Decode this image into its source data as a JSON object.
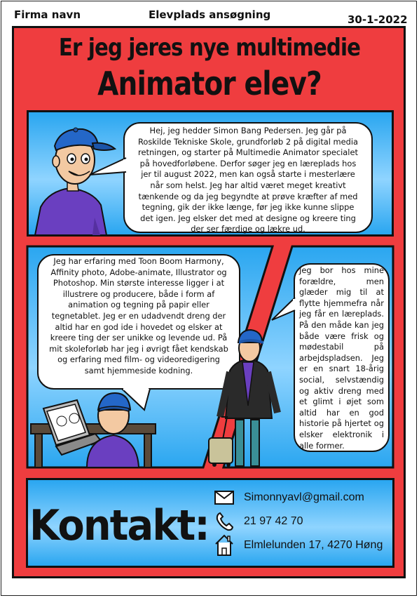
{
  "header": {
    "company": "Firma navn",
    "subject": "Elevplads ansøgning",
    "date": "30-1-2022"
  },
  "title": {
    "line1": "Er jeg jeres nye multimedie",
    "line2": "Animator elev?"
  },
  "panels": {
    "intro_text": "Hej, jeg hedder Simon Bang Pedersen. Jeg går på Roskilde Tekniske Skole, grundforløb 2 på digital media retningen, og starter på Multimedie Animator specialet på hovedforløbene. Derfor søger jeg en læreplads hos jer til august 2022, men kan også starte i mesterlære når som helst. Jeg har altid været meget kreativt tænkende og da jeg begyndte at prøve kræfter af med tegning, gik der ikke længe, før jeg ikke kunne slippe det igen. Jeg elsker det med at designe og kreere ting der ser færdige og lækre ud.",
    "experience_text": "Jeg har erfaring med Toon Boom Harmony, Affinity photo, Adobe-animate, Illustrator og Photoshop. Min største interesse ligger i at illustrere og producere, både i form af animation og tegning på papir eller tegnetablet. Jeg er en udadvendt dreng der altid har en god ide i hovedet og elsker at kreere ting der ser unikke og levende ud. På mit skoleforløb har jeg i øvrigt fået kendskab og erfaring med film- og videoredigering samt hjemmeside kodning.",
    "personal_text": "Jeg bor hos mine forældre, men glæder mig til at flytte hjemmefra når jeg får en læreplads. På den måde kan jeg både være frisk og mødestabil på arbejdspladsen. Jeg er en snart 18-årig social, selvstændig og aktiv dreng med et glimt i øjet som altid har en god historie på hjertet og elsker elektronik i alle former."
  },
  "contact": {
    "heading": "Kontakt:",
    "email": "Simonnyavl@gmail.com",
    "phone": "21 97 42 70",
    "address": "Elmlelunden 17, 4270 Høng"
  },
  "colors": {
    "background_red": "#ef3d3f",
    "panel_blue": "#2aa6f0",
    "cap_blue": "#2467c8",
    "shirt_purple": "#6a3fc0"
  },
  "icons": [
    "envelope-icon",
    "phone-icon",
    "house-icon"
  ]
}
